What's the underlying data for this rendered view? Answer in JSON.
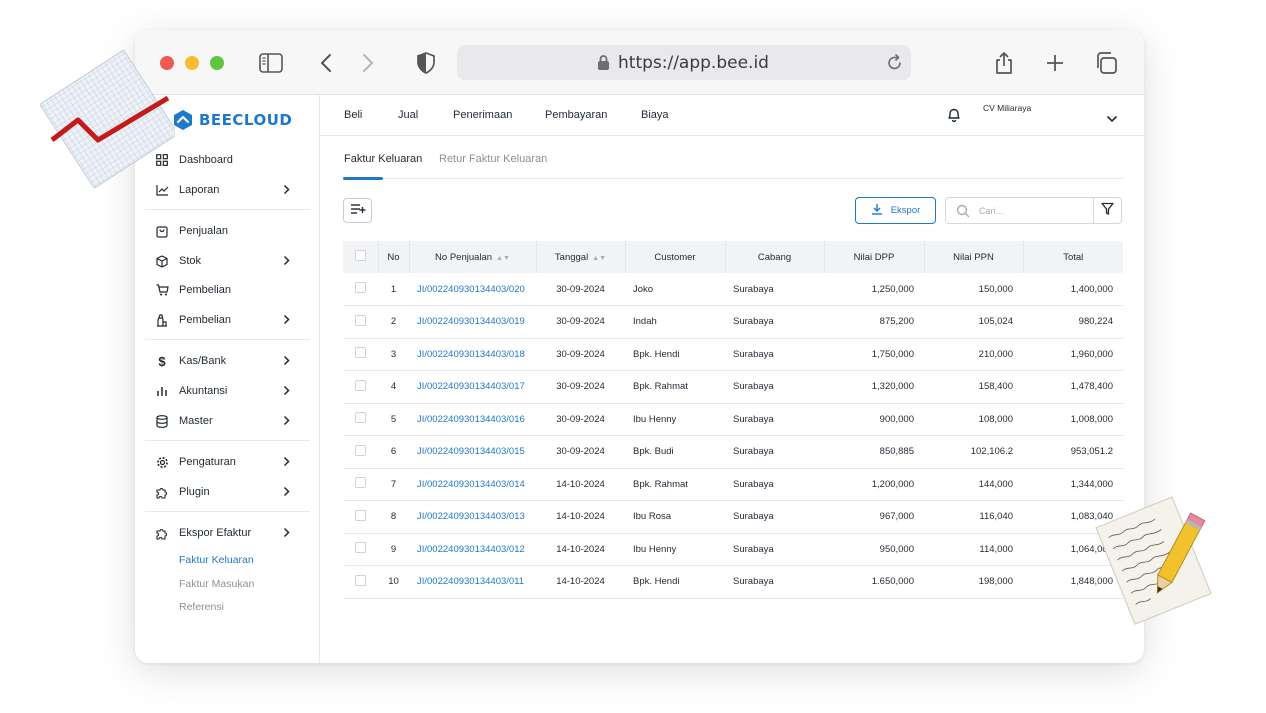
{
  "browser": {
    "url": "https://app.bee.id"
  },
  "app": {
    "logo_text": "BEECLOUD",
    "company": "CV Miliaraya"
  },
  "sidebar": {
    "items": [
      {
        "label": "Dashboard",
        "icon": "grid-icon",
        "chevron": false
      },
      {
        "label": "Laporan",
        "icon": "chart-line-icon",
        "chevron": true
      },
      {
        "label": "Penjualan",
        "icon": "shopping-bag-icon",
        "chevron": false
      },
      {
        "label": "Stok",
        "icon": "box-icon",
        "chevron": true
      },
      {
        "label": "Pembelian",
        "icon": "cart-icon",
        "chevron": false
      },
      {
        "label": "Pembelian",
        "icon": "factory-icon",
        "chevron": true
      },
      {
        "label": "Kas/Bank",
        "icon": "dollar-icon",
        "chevron": true
      },
      {
        "label": "Akuntansi",
        "icon": "bar-chart-icon",
        "chevron": true
      },
      {
        "label": "Master",
        "icon": "database-icon",
        "chevron": true
      },
      {
        "label": "Pengaturan",
        "icon": "gear-icon",
        "chevron": true
      },
      {
        "label": "Plugin",
        "icon": "puzzle-icon",
        "chevron": true
      },
      {
        "label": "Ekspor Efaktur",
        "icon": "puzzle-icon",
        "chevron": true
      }
    ],
    "subitems": [
      "Faktur Keluaran",
      "Faktur Masukan",
      "Referensi"
    ]
  },
  "topnav": {
    "menus": [
      "Beli",
      "Jual",
      "Penerimaan",
      "Pembayaran",
      "Biaya"
    ]
  },
  "tabs": [
    "Faktur Keluaran",
    "Retur Faktur Keluaran"
  ],
  "toolbar": {
    "export_label": "Ekspor",
    "search_placeholder": "Cari..."
  },
  "table": {
    "headers": [
      "No",
      "No Penjualan",
      "Tanggal",
      "Customer",
      "Cabang",
      "Nilai DPP",
      "Nilai PPN",
      "Total"
    ],
    "rows": [
      {
        "no": "1",
        "no_penjualan": "JI/002240930134403/020",
        "tanggal": "30-09-2024",
        "customer": "Joko",
        "cabang": "Surabaya",
        "dpp": "1,250,000",
        "ppn": "150,000",
        "total": "1,400,000"
      },
      {
        "no": "2",
        "no_penjualan": "JI/002240930134403/019",
        "tanggal": "30-09-2024",
        "customer": "Indah",
        "cabang": "Surabaya",
        "dpp": "875,200",
        "ppn": "105,024",
        "total": "980,224"
      },
      {
        "no": "3",
        "no_penjualan": "JI/002240930134403/018",
        "tanggal": "30-09-2024",
        "customer": "Bpk. Hendi",
        "cabang": "Surabaya",
        "dpp": "1,750,000",
        "ppn": "210,000",
        "total": "1,960,000"
      },
      {
        "no": "4",
        "no_penjualan": "JI/002240930134403/017",
        "tanggal": "30-09-2024",
        "customer": "Bpk. Rahmat",
        "cabang": "Surabaya",
        "dpp": "1,320,000",
        "ppn": "158,400",
        "total": "1,478,400"
      },
      {
        "no": "5",
        "no_penjualan": "JI/002240930134403/016",
        "tanggal": "30-09-2024",
        "customer": "Ibu Henny",
        "cabang": "Surabaya",
        "dpp": "900,000",
        "ppn": "108,000",
        "total": "1,008,000"
      },
      {
        "no": "6",
        "no_penjualan": "JI/002240930134403/015",
        "tanggal": "30-09-2024",
        "customer": "Bpk. Budi",
        "cabang": "Surabaya",
        "dpp": "850,885",
        "ppn": "102,106.2",
        "total": "953,051.2"
      },
      {
        "no": "7",
        "no_penjualan": "JI/002240930134403/014",
        "tanggal": "14-10-2024",
        "customer": "Bpk. Rahmat",
        "cabang": "Surabaya",
        "dpp": "1,200,000",
        "ppn": "144,000",
        "total": "1,344,000"
      },
      {
        "no": "8",
        "no_penjualan": "JI/002240930134403/013",
        "tanggal": "14-10-2024",
        "customer": "Ibu Rosa",
        "cabang": "Surabaya",
        "dpp": "967,000",
        "ppn": "116,040",
        "total": "1,083,040"
      },
      {
        "no": "9",
        "no_penjualan": "JI/002240930134403/012",
        "tanggal": "14-10-2024",
        "customer": "Ibu Henny",
        "cabang": "Surabaya",
        "dpp": "950,000",
        "ppn": "114,000",
        "total": "1,064,000"
      },
      {
        "no": "10",
        "no_penjualan": "JI/002240930134403/011",
        "tanggal": "14-10-2024",
        "customer": "Bpk. Hendi",
        "cabang": "Surabaya",
        "dpp": "1.650,000",
        "ppn": "198,000",
        "total": "1,848,000"
      }
    ]
  },
  "colors": {
    "accent": "#1f78c9",
    "text": "#1f2933",
    "muted": "#8b9097"
  }
}
